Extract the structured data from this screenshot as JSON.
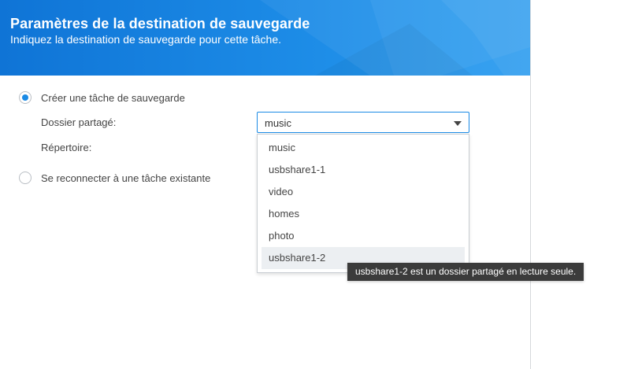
{
  "header": {
    "title": "Paramètres de la destination de sauvegarde",
    "subtitle": "Indiquez la destination de sauvegarde pour cette tâche."
  },
  "options": {
    "create_label": "Créer une tâche de sauvegarde",
    "create_selected": true,
    "reconnect_label": "Se reconnecter à une tâche existante",
    "reconnect_selected": false
  },
  "fields": {
    "shared_folder_label": "Dossier partagé:",
    "directory_label": "Répertoire:"
  },
  "shared_folder_select": {
    "value": "music",
    "options": [
      "music",
      "usbshare1-1",
      "video",
      "homes",
      "photo",
      "usbshare1-2"
    ],
    "hovered_option": "usbshare1-2"
  },
  "tooltip": {
    "text": "usbshare1-2 est un dossier partagé en lecture seule."
  },
  "colors": {
    "accent": "#1a8ae5",
    "header_start": "#0f74d6",
    "header_end": "#2b9cf0",
    "tooltip_bg": "#3b3b3b"
  }
}
